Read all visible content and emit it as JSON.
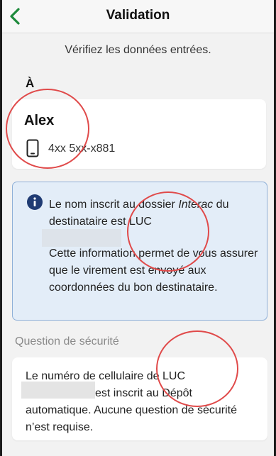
{
  "header": {
    "title": "Validation",
    "back_icon": "chevron-left-icon"
  },
  "subtitle": "Vérifiez les données entrées.",
  "recipient": {
    "section_label": "À",
    "name": "Alex",
    "phone": "4xx 5xx-x881",
    "phone_icon": "mobile-phone-icon"
  },
  "info": {
    "icon": "info-icon",
    "line1_prefix": "Le nom inscrit au dossier ",
    "line1_italic": "Interac",
    "line1_suffix": " du destinataire est LUC",
    "line2": "Cette information permet de vous assurer que le virement est envoyé aux coordonnées du bon destinataire."
  },
  "security": {
    "label": "Question de sécurité",
    "text_line1": "Le numéro de cellulaire de LUC",
    "text_rest": "est inscrit au Dépôt automatique. Aucune question de sécurité n’est requise."
  },
  "colors": {
    "accent_green": "#1e8a3c",
    "info_blue": "#1f3b73",
    "annotation_red": "#e04a4a"
  }
}
